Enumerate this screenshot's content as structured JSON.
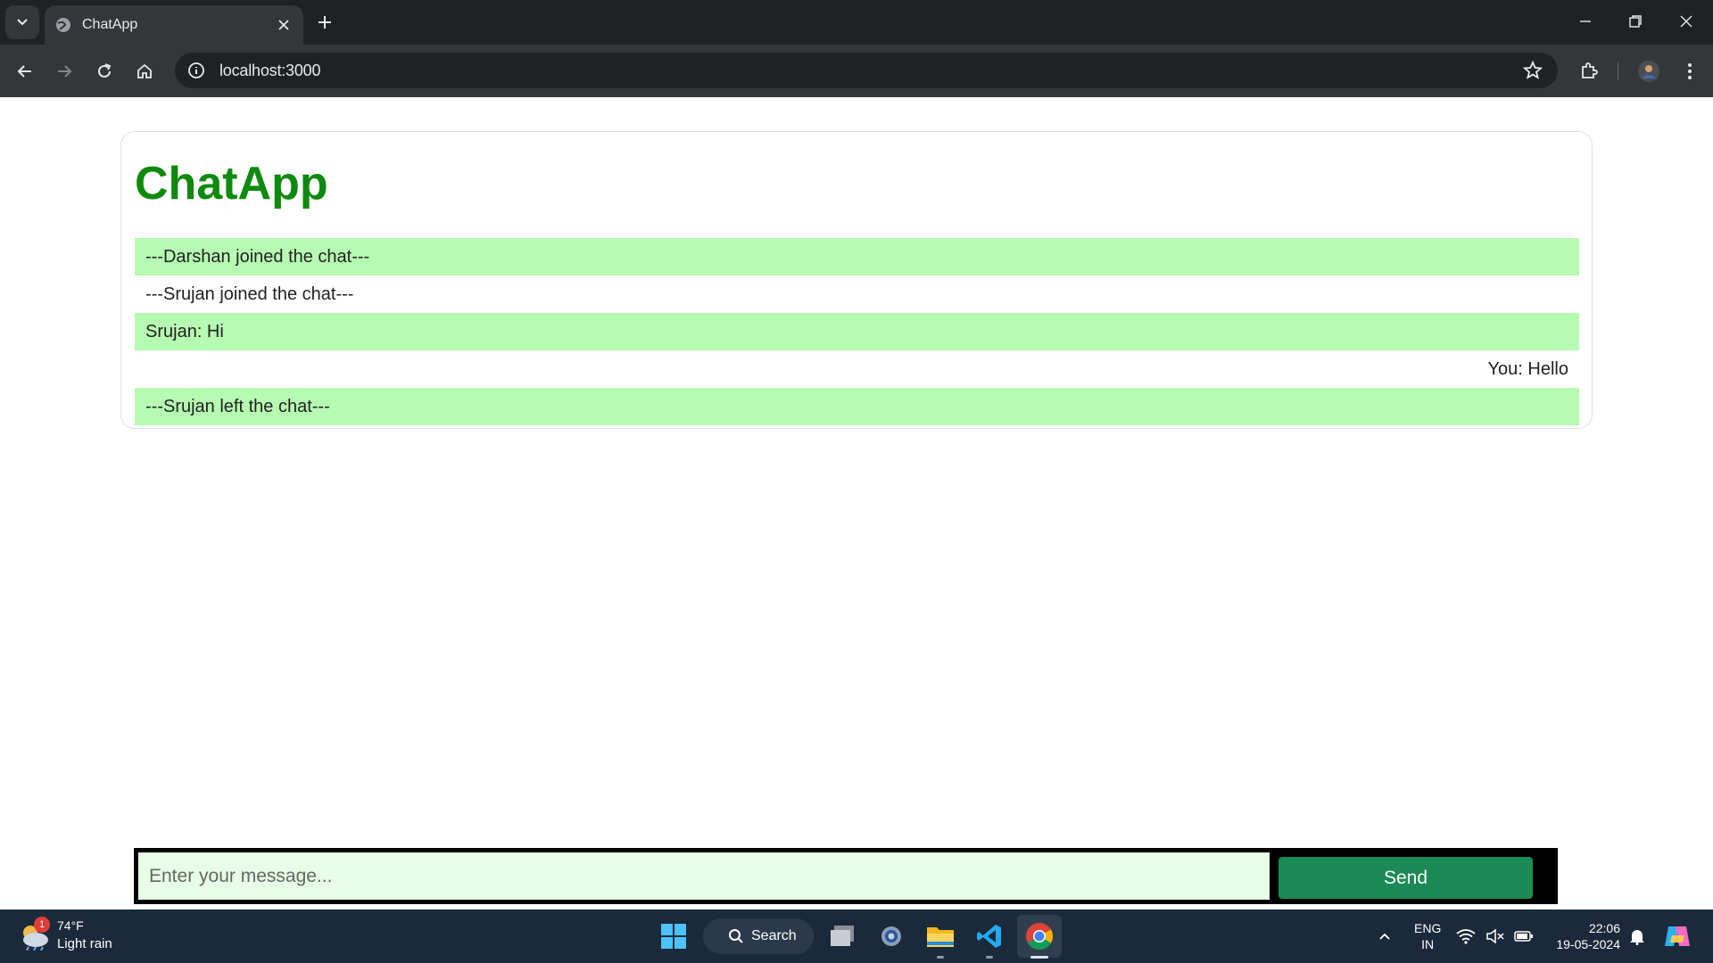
{
  "browser": {
    "tab_title": "ChatApp",
    "url": "localhost:3000"
  },
  "app": {
    "title": "ChatApp",
    "title_color": "#0e8a0e",
    "highlight_color": "#b6fbb2",
    "messages": [
      {
        "text": "---Darshan joined the chat---",
        "highlight": true,
        "align": "left"
      },
      {
        "text": "---Srujan joined the chat---",
        "highlight": false,
        "align": "left"
      },
      {
        "text": "Srujan: Hi",
        "highlight": true,
        "align": "left"
      },
      {
        "text": "You: Hello",
        "highlight": false,
        "align": "right"
      },
      {
        "text": "---Srujan left the chat---",
        "highlight": true,
        "align": "left"
      }
    ],
    "composer": {
      "placeholder": "Enter your message...",
      "value": "",
      "send_label": "Send",
      "send_color": "#1b8a55"
    }
  },
  "taskbar": {
    "weather": {
      "temp": "74°F",
      "condition": "Light rain",
      "badge": "1"
    },
    "search_label": "Search",
    "lang_line1": "ENG",
    "lang_line2": "IN",
    "time": "22:06",
    "date": "19-05-2024"
  }
}
